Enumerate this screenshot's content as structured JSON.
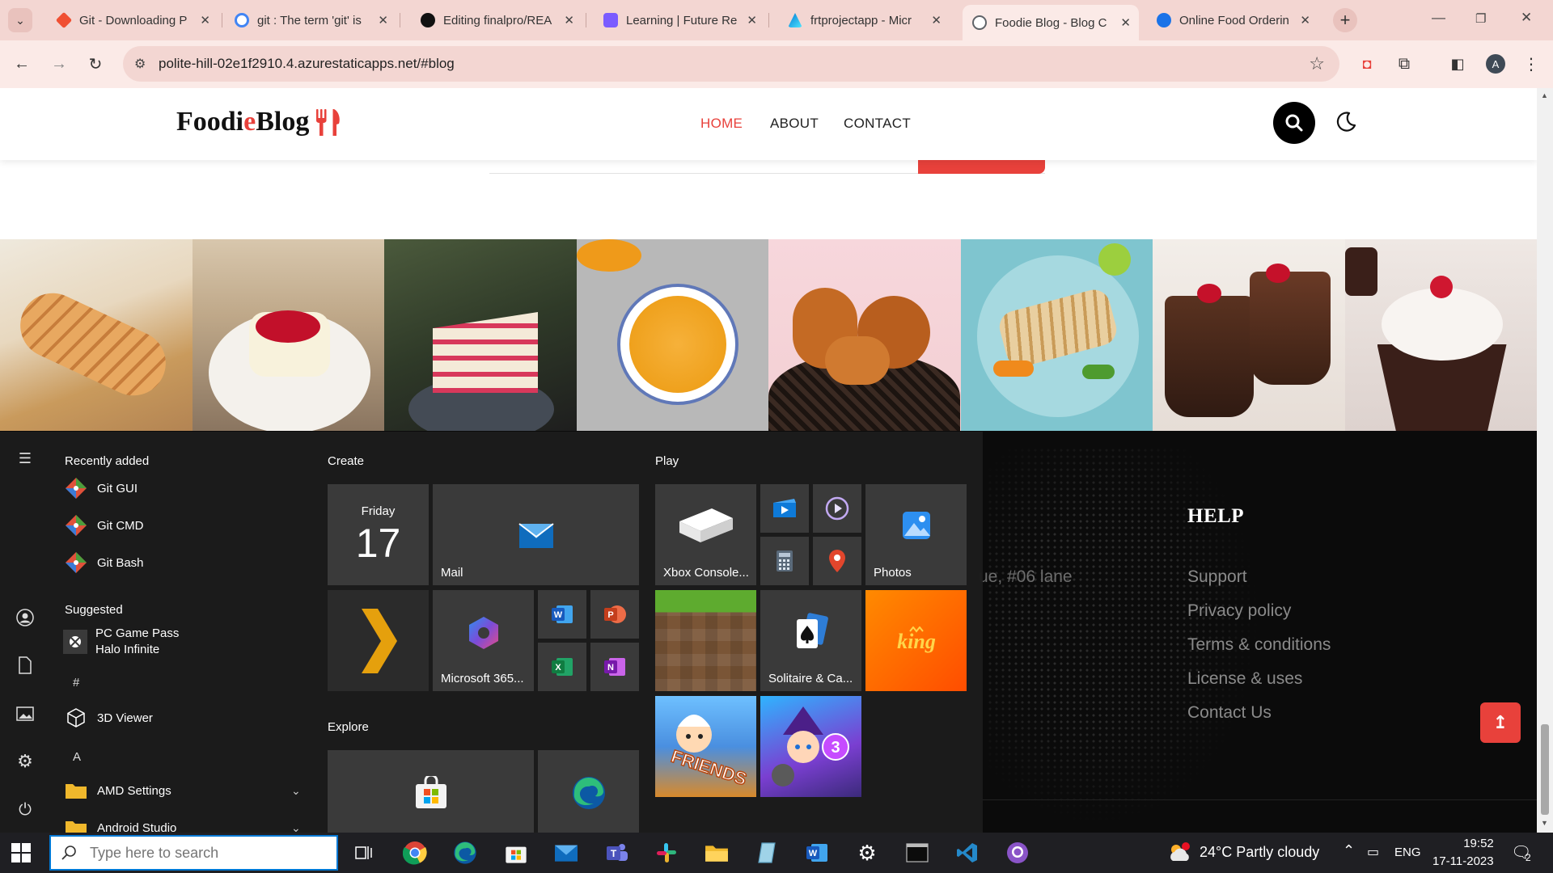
{
  "browser": {
    "tabs": [
      {
        "title": "Git - Downloading P",
        "icon": "git-icon",
        "color": "#f05033"
      },
      {
        "title": "git : The term 'git' is",
        "icon": "google-icon",
        "color": "#4285f4"
      },
      {
        "title": "Editing finalpro/REA",
        "icon": "github-icon",
        "color": "#111111"
      },
      {
        "title": "Learning | Future Re",
        "icon": "course-icon",
        "color": "#7a5cff"
      },
      {
        "title": "frtprojectapp - Micr",
        "icon": "azure-icon",
        "color": "#0078d4"
      },
      {
        "title": "Foodie Blog - Blog C",
        "icon": "globe-icon",
        "color": "#5f6368"
      },
      {
        "title": "Online Food Orderin",
        "icon": "globe-blue-icon",
        "color": "#1a73e8"
      }
    ],
    "active_tab": 5,
    "url": "polite-hill-02e1f2910.4.azurestaticapps.net/#blog",
    "profile_initial": "A"
  },
  "site": {
    "logo_part1": "Foodi",
    "logo_part2": "e",
    "logo_part3": " Blog",
    "nav": {
      "home": "HOME",
      "about": "ABOUT",
      "contact": "CONTACT"
    },
    "accent": "#e8413b",
    "gallery": [
      "bread",
      "panna cotta",
      "raspberry cake",
      "pumpkin soup",
      "fried chicken",
      "grilled fish",
      "chocolate mousse",
      "cupcake"
    ],
    "footer": {
      "address_fragment": "ue, #06 lane",
      "help_title": "HELP",
      "help_links": [
        "Support",
        "Privacy policy",
        "Terms & conditions",
        "License & uses",
        "Contact Us"
      ]
    }
  },
  "start_menu": {
    "recently_added": "Recently added",
    "recent_apps": [
      "Git GUI",
      "Git CMD",
      "Git Bash"
    ],
    "suggested": "Suggested",
    "suggested_app_line1": "PC Game Pass",
    "suggested_app_line2": "Halo Infinite",
    "letter_hash": "#",
    "viewer": "3D Viewer",
    "letter_a": "A",
    "amd": "AMD Settings",
    "android": "Android Studio",
    "create": "Create",
    "play": "Play",
    "explore": "Explore",
    "calendar_day": "Friday",
    "calendar_date": "17",
    "mail": "Mail",
    "m365": "Microsoft 365...",
    "xbox": "Xbox Console...",
    "photos": "Photos",
    "solitaire": "Solitaire & Ca..."
  },
  "taskbar": {
    "search_placeholder": "Type here to search",
    "weather": "24°C  Partly cloudy",
    "lang": "ENG",
    "time": "19:52",
    "date": "17-11-2023",
    "notifications": "2"
  }
}
